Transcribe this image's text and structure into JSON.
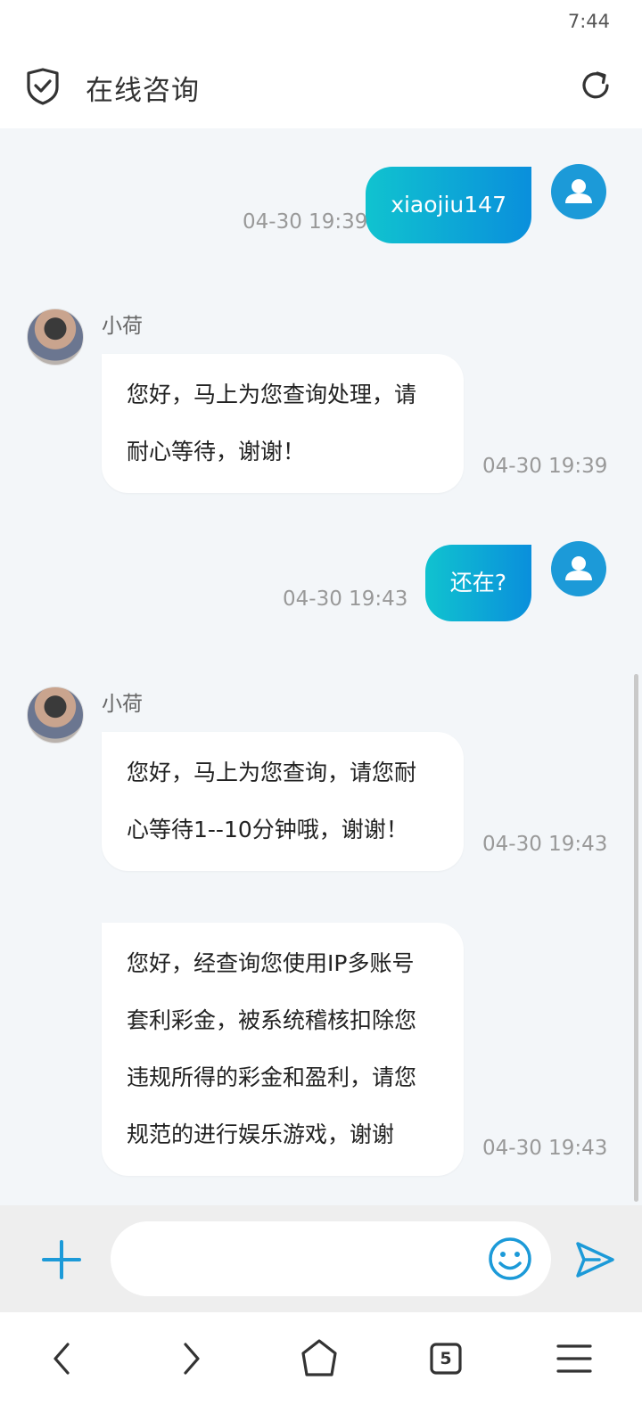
{
  "status": {
    "time": "7:44"
  },
  "header": {
    "title": "在线咨询"
  },
  "messages": [
    {
      "side": "out",
      "text": "xiaojiu147",
      "time": "04-30 19:39"
    },
    {
      "side": "in",
      "name": "小荷",
      "lines": [
        "您好，马上为您查询处理，请",
        "耐心等待，谢谢！"
      ],
      "time": "04-30 19:39"
    },
    {
      "side": "out",
      "text": "还在?",
      "time": "04-30 19:43"
    },
    {
      "side": "in",
      "name": "小荷",
      "lines": [
        "您好，马上为您查询，请您耐",
        "心等待1--10分钟哦，谢谢！"
      ],
      "time": "04-30 19:43"
    },
    {
      "side": "in",
      "lines": [
        "您好，经查询您使用IP多账号",
        "套利彩金，被系统稽核扣除您",
        "违规所得的彩金和盈利，请您",
        "规范的进行娱乐游戏，谢谢"
      ],
      "time": "04-30 19:43"
    }
  ],
  "input": {
    "placeholder": ""
  },
  "nav": {
    "tabs_count": "5"
  },
  "colors": {
    "accent": "#1c9ad8",
    "bubble_start": "#10c3cf",
    "bubble_end": "#0a8fdc",
    "chat_bg": "#f3f6f9"
  },
  "icons": [
    "shield-check-icon",
    "refresh-icon",
    "user-icon",
    "plus-icon",
    "emoji-icon",
    "send-icon",
    "back-icon",
    "forward-icon",
    "home-icon",
    "tabs-icon",
    "menu-icon"
  ]
}
